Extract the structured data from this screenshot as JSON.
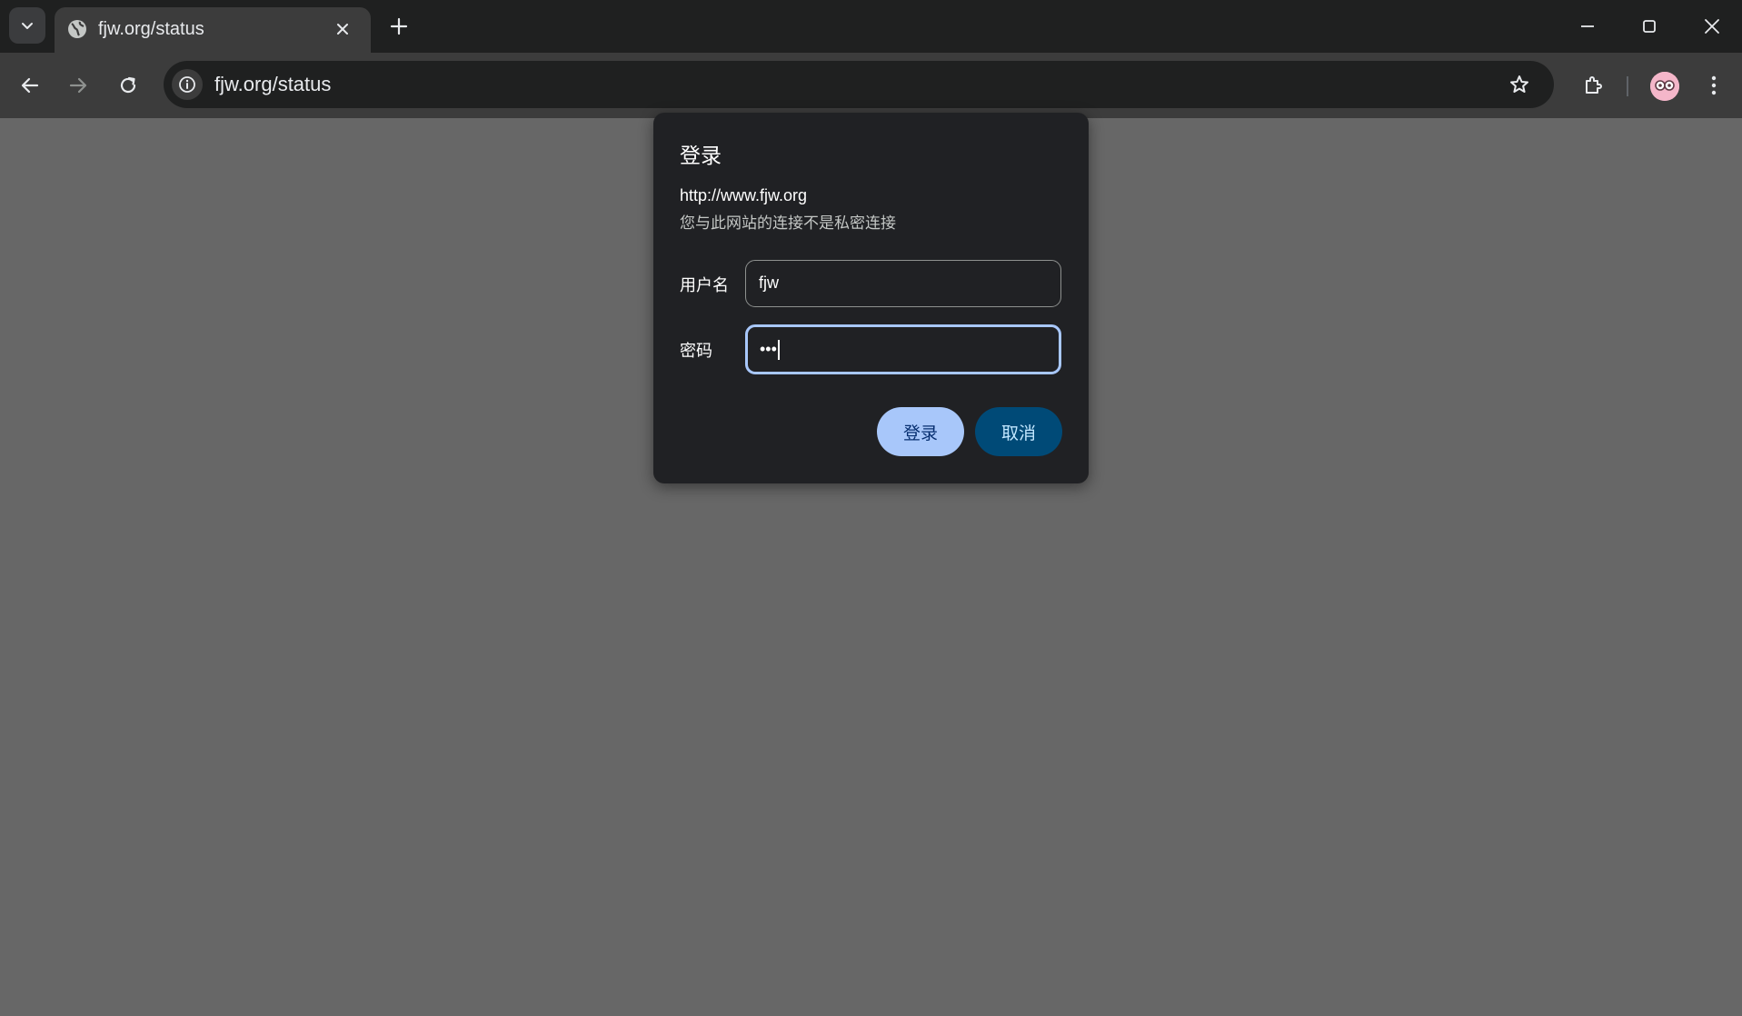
{
  "browser": {
    "tab": {
      "title": "fjw.org/status"
    },
    "address_bar": {
      "url": "fjw.org/status"
    }
  },
  "dialog": {
    "title": "登录",
    "origin": "http://www.fjw.org",
    "warning": "您与此网站的连接不是私密连接",
    "username_label": "用户名",
    "username_value": "fjw",
    "password_label": "密码",
    "password_masked": "•••",
    "login_button": "登录",
    "cancel_button": "取消"
  },
  "colors": {
    "page_overlay": "#676767",
    "dialog_bg": "#202124",
    "primary_button": "#a8c7fa",
    "secondary_button": "#004a77",
    "focus_ring": "#a8c7fa"
  },
  "icons": {
    "tab_search": "chevron-down-icon",
    "favicon": "globe-icon",
    "tab_close": "close-icon",
    "new_tab": "plus-icon",
    "back": "arrow-left-icon",
    "forward": "arrow-right-icon",
    "reload": "reload-icon",
    "site_info": "info-icon",
    "bookmark": "star-icon",
    "extensions": "puzzle-icon",
    "profile": "avatar-icon",
    "menu": "kebab-menu-icon"
  }
}
